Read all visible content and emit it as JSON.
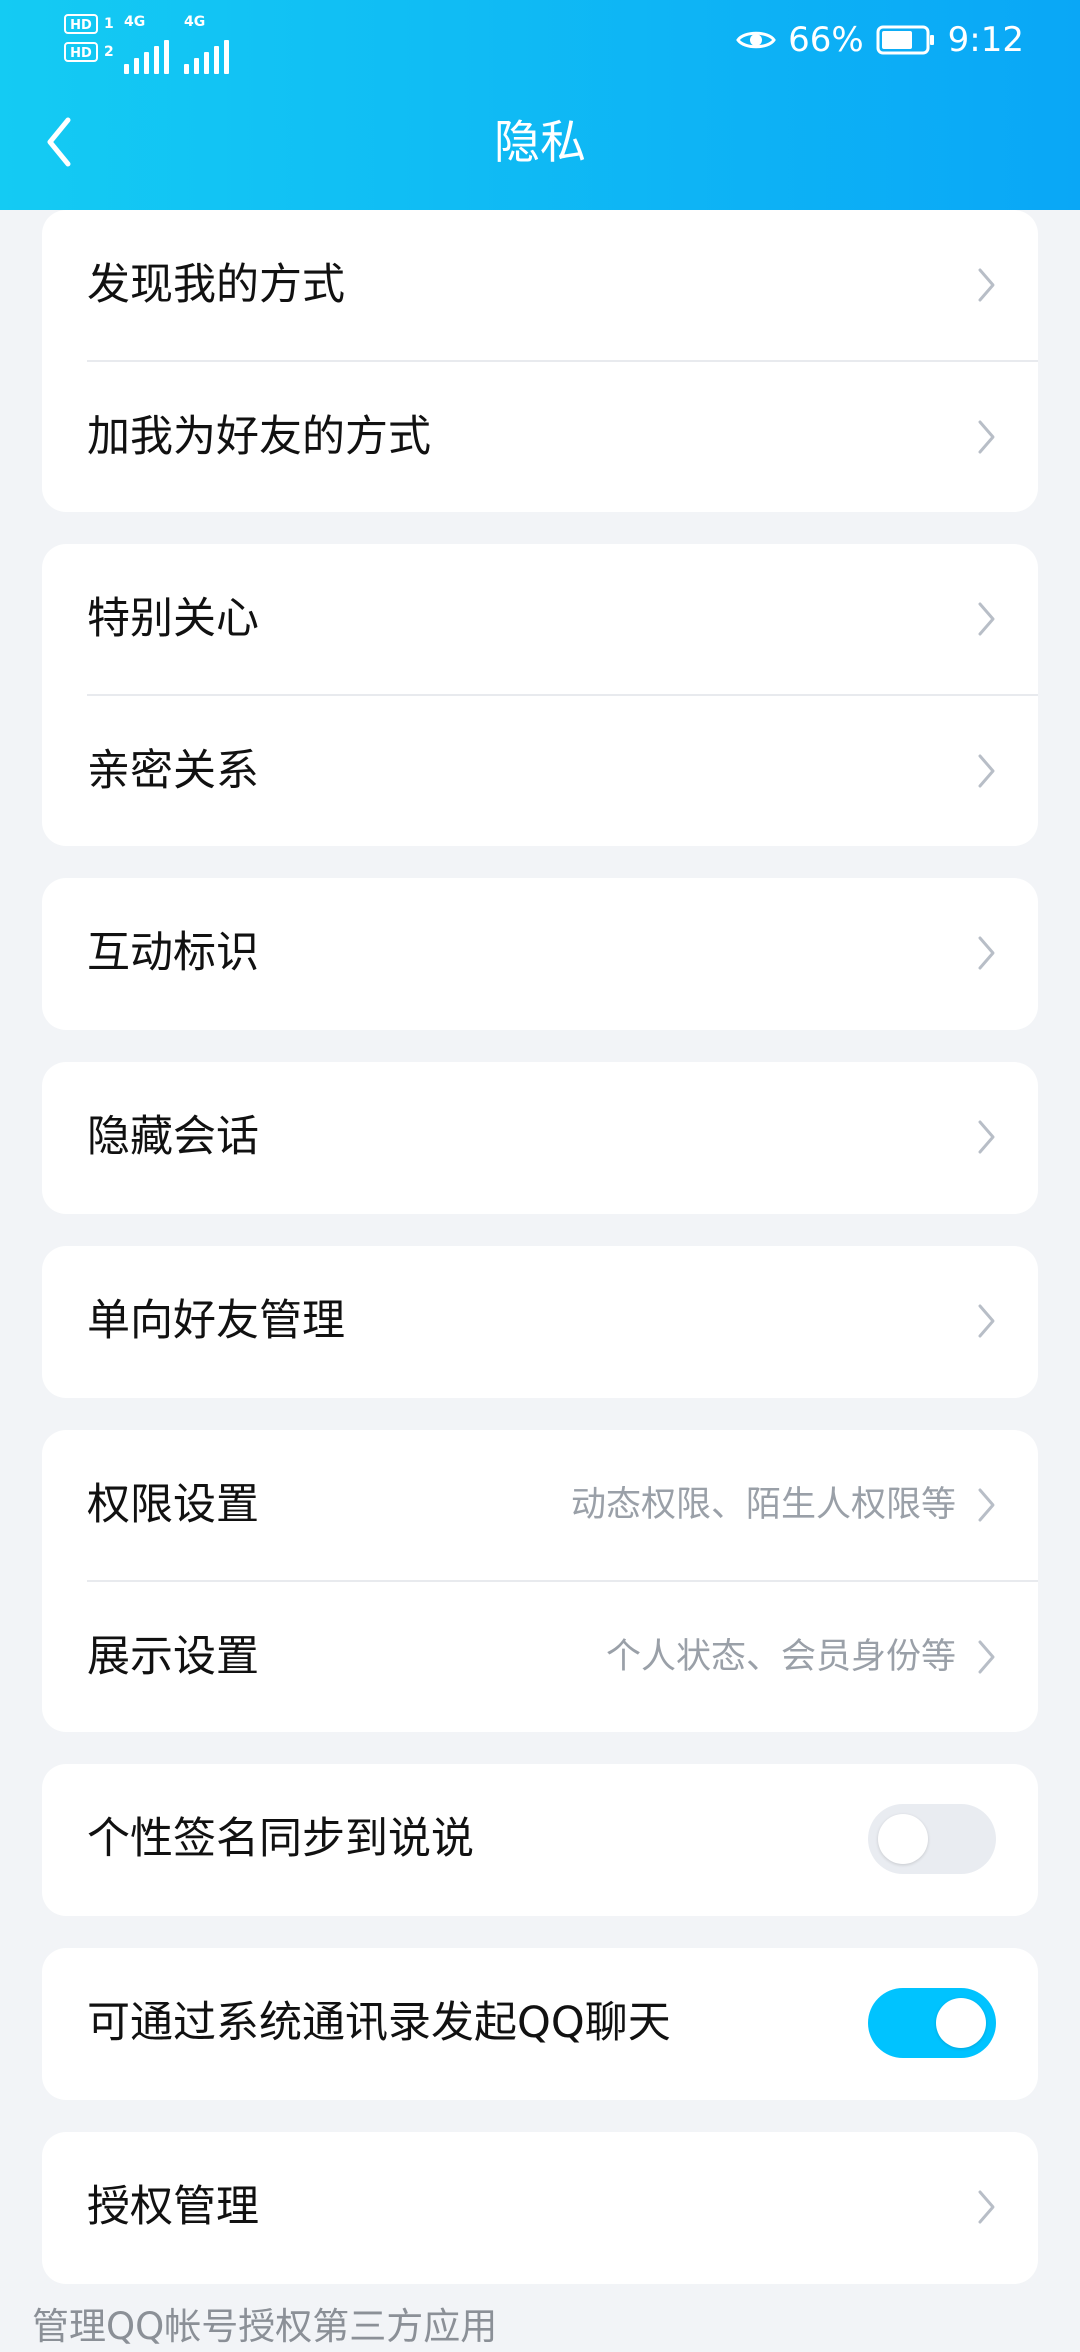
{
  "status_bar": {
    "sim1_label": "HD",
    "sim1_num": "1",
    "sim2_label": "HD",
    "sim2_num": "2",
    "network1": "4G",
    "network2": "4G",
    "battery": "66%",
    "time": "9:12"
  },
  "header": {
    "title": "隐私"
  },
  "sections": [
    {
      "items": [
        {
          "label": "发现我的方式"
        },
        {
          "label": "加我为好友的方式"
        }
      ]
    },
    {
      "items": [
        {
          "label": "特别关心"
        },
        {
          "label": "亲密关系"
        }
      ]
    },
    {
      "items": [
        {
          "label": "互动标识"
        }
      ]
    },
    {
      "items": [
        {
          "label": "隐藏会话"
        }
      ]
    },
    {
      "items": [
        {
          "label": "单向好友管理"
        }
      ]
    },
    {
      "items": [
        {
          "label": "权限设置",
          "sub": "动态权限、陌生人权限等"
        },
        {
          "label": "展示设置",
          "sub": "个人状态、会员身份等"
        }
      ]
    },
    {
      "items": [
        {
          "label": "个性签名同步到说说",
          "toggle": false
        }
      ]
    },
    {
      "items": [
        {
          "label": "可通过系统通讯录发起QQ聊天",
          "toggle": true
        }
      ]
    },
    {
      "items": [
        {
          "label": "授权管理"
        }
      ]
    }
  ],
  "footer": {
    "note": "管理QQ帐号授权第三方应用"
  },
  "colors": {
    "header_start": "#14cbf3",
    "header_end": "#0aa7f6",
    "toggle_on": "#00c3ff",
    "toggle_off": "#e9ecf1",
    "page_background": "#f2f4f7"
  }
}
